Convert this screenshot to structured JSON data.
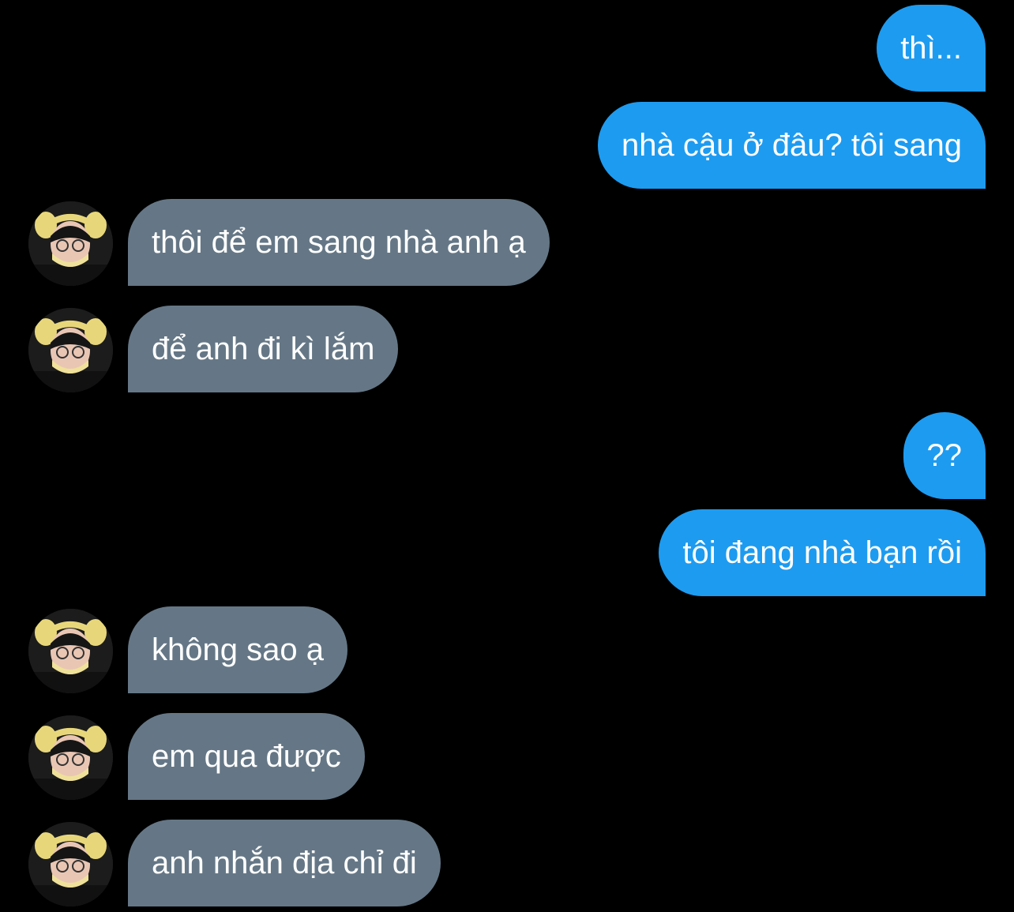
{
  "conversation": {
    "messages": [
      {
        "side": "out",
        "text": "thì..."
      },
      {
        "side": "out",
        "text": "nhà cậu ở đâu? tôi sang"
      },
      {
        "side": "in",
        "text": "thôi để em sang nhà anh ạ"
      },
      {
        "side": "in",
        "text": "để anh đi kì lắm"
      },
      {
        "side": "out",
        "text": "??"
      },
      {
        "side": "out",
        "text": "tôi đang nhà bạn rồi"
      },
      {
        "side": "in",
        "text": "không sao ạ"
      },
      {
        "side": "in",
        "text": "em qua được"
      },
      {
        "side": "in",
        "text": "anh nhắn địa chỉ đi"
      }
    ]
  },
  "colors": {
    "background": "#000000",
    "outgoing_bubble": "#1d9bf0",
    "incoming_bubble": "#657786",
    "text": "#ffffff"
  },
  "icons": {
    "contact_avatar": "person-avatar-with-yellow-ear-headband"
  }
}
